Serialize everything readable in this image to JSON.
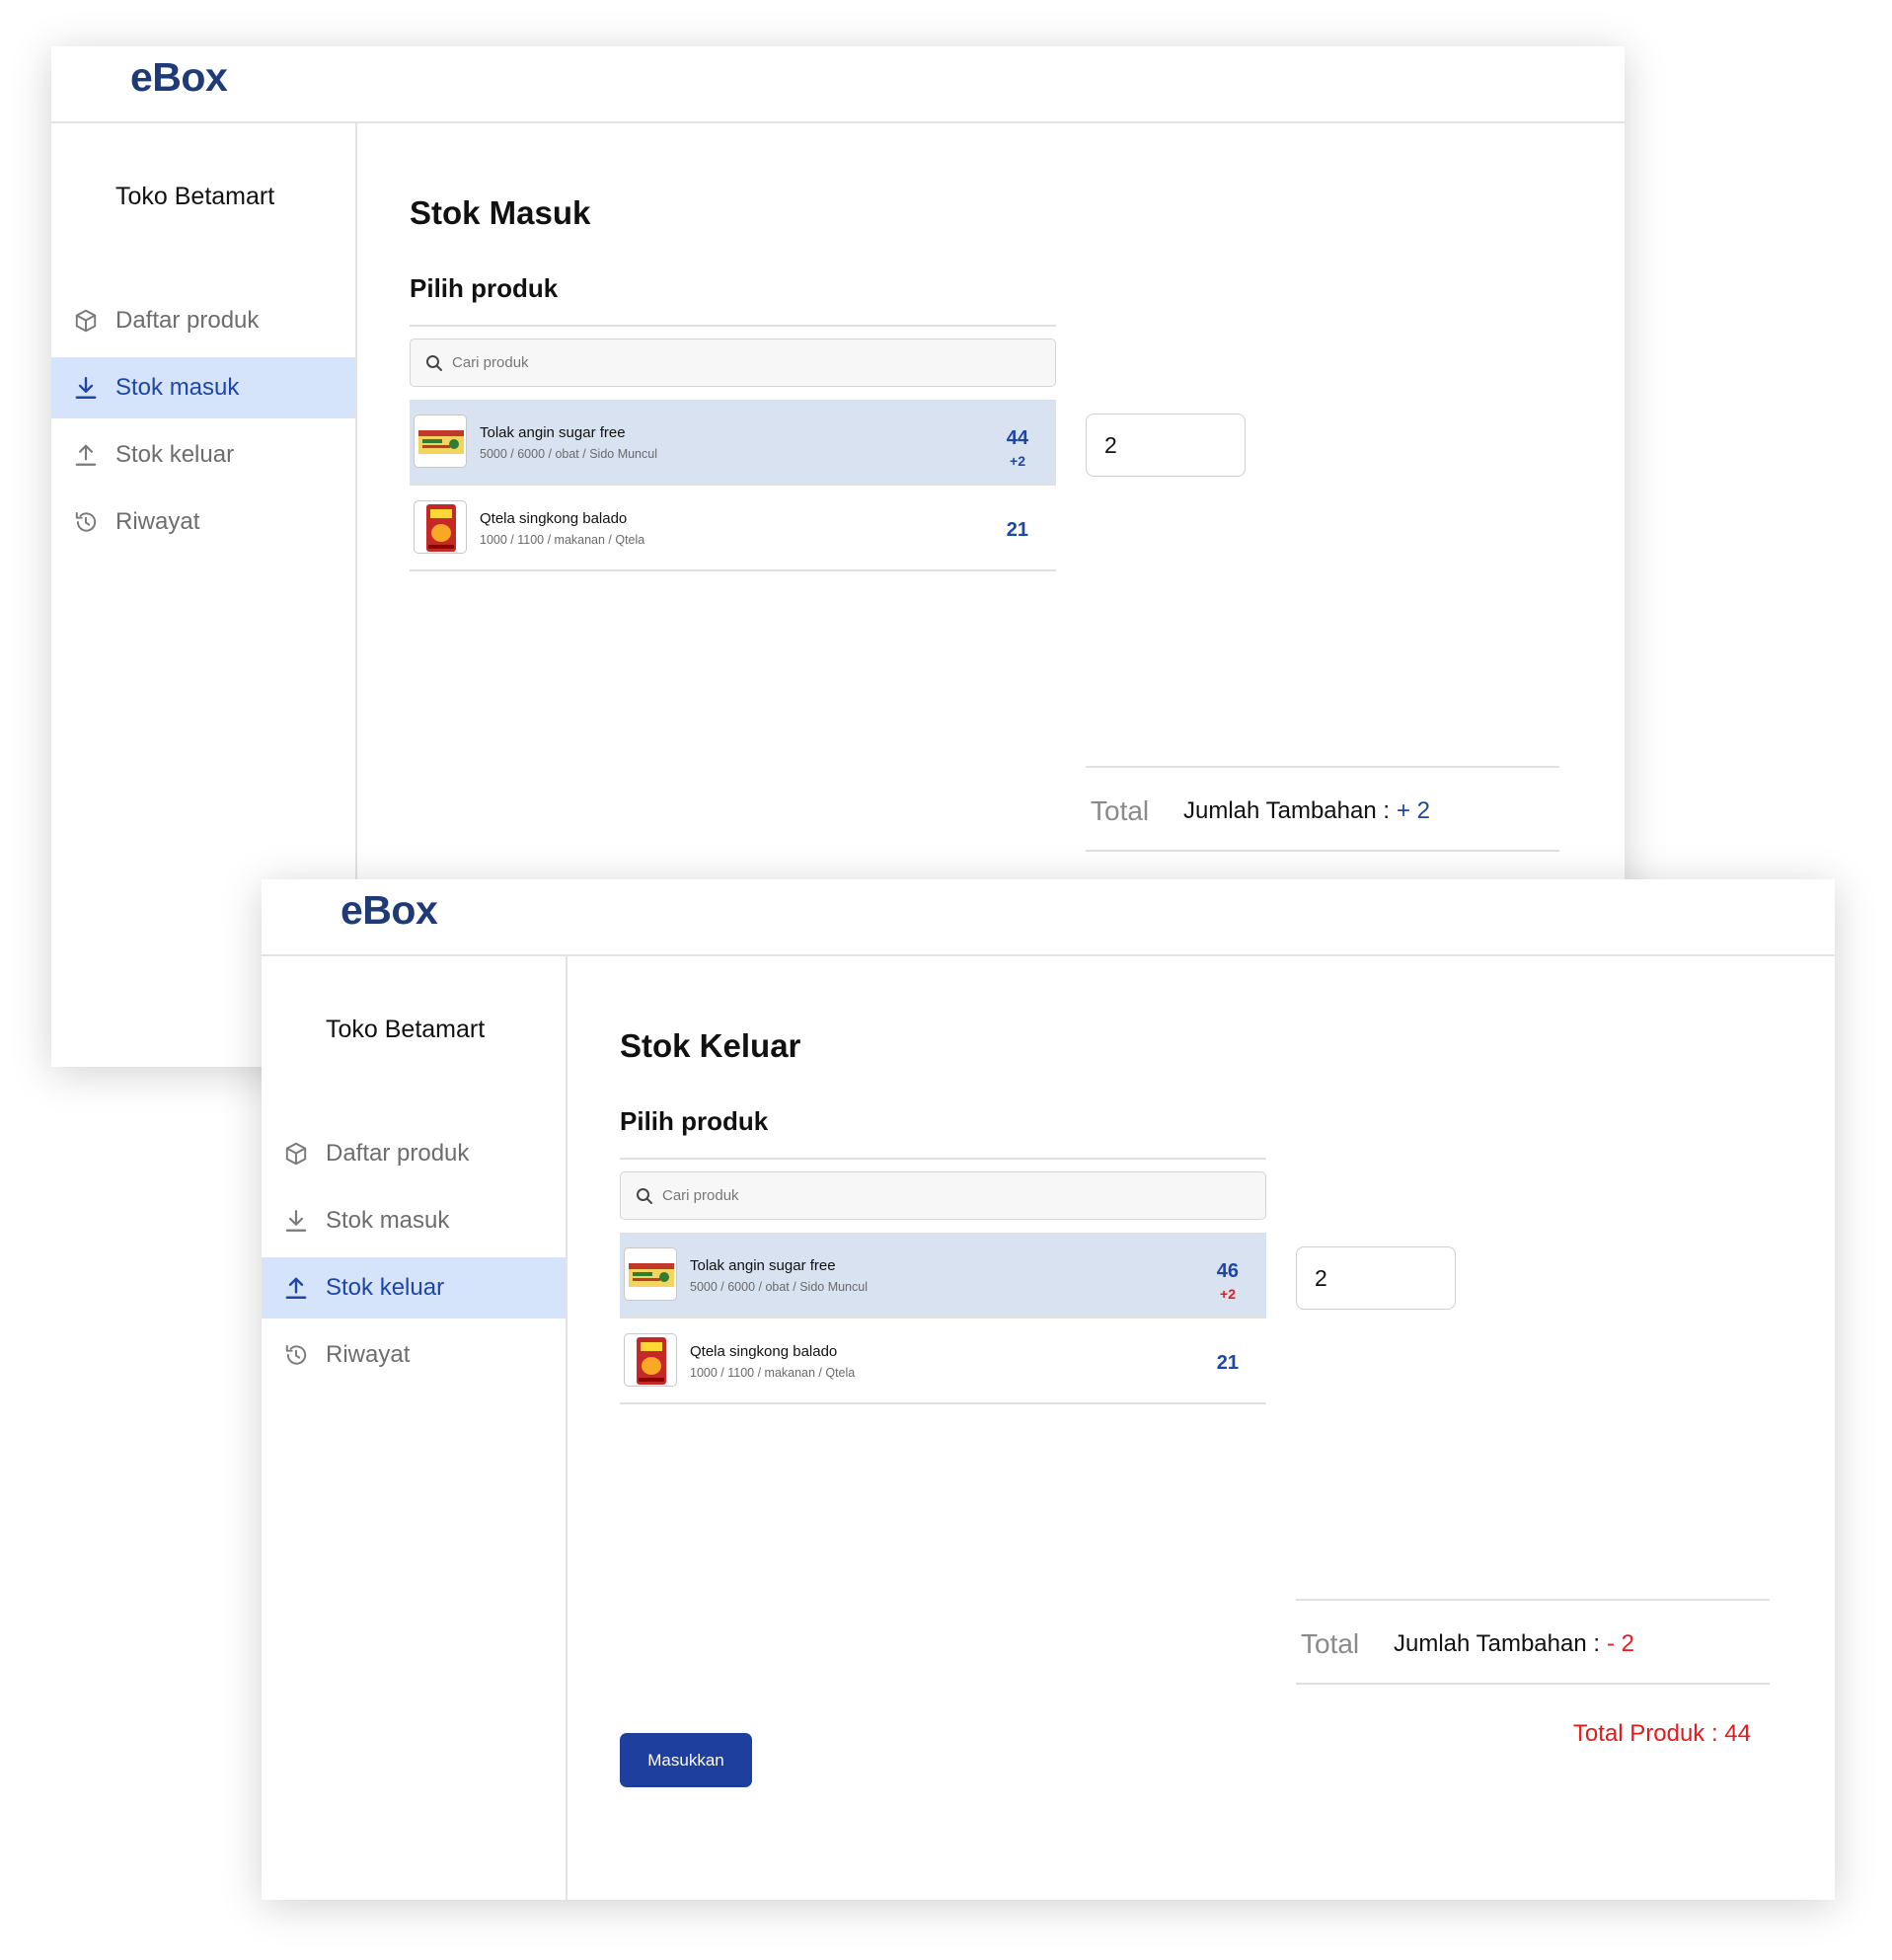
{
  "screens": [
    {
      "logo": "eBox",
      "store_name": "Toko Betamart",
      "nav": [
        {
          "label": "Daftar produk",
          "icon": "box-icon",
          "active": false
        },
        {
          "label": "Stok masuk",
          "icon": "download-icon",
          "active": true
        },
        {
          "label": "Stok keluar",
          "icon": "upload-icon",
          "active": false
        },
        {
          "label": "Riwayat",
          "icon": "history-icon",
          "active": false
        }
      ],
      "page_title": "Stok Masuk",
      "section_title": "Pilih produk",
      "search": {
        "placeholder": "Cari produk",
        "value": ""
      },
      "products": [
        {
          "name": "Tolak angin sugar free",
          "meta": "5000 / 6000 / obat / Sido Muncul",
          "count": "44",
          "delta": "+2",
          "selected": true
        },
        {
          "name": "Qtela singkong balado",
          "meta": "1000 / 1100 / makanan / Qtela",
          "count": "21",
          "delta": "",
          "selected": false
        }
      ],
      "quantity": "2",
      "total_label": "Total",
      "jumlah_label": "Jumlah Tambahan :",
      "jumlah_value": "+ 2"
    },
    {
      "logo": "eBox",
      "store_name": "Toko Betamart",
      "nav": [
        {
          "label": "Daftar produk",
          "icon": "box-icon",
          "active": false
        },
        {
          "label": "Stok masuk",
          "icon": "download-icon",
          "active": false
        },
        {
          "label": "Stok keluar",
          "icon": "upload-icon",
          "active": true
        },
        {
          "label": "Riwayat",
          "icon": "history-icon",
          "active": false
        }
      ],
      "page_title": "Stok Keluar",
      "section_title": "Pilih produk",
      "search": {
        "placeholder": "Cari produk",
        "value": ""
      },
      "products": [
        {
          "name": "Tolak angin sugar free",
          "meta": "5000 / 6000 / obat / Sido Muncul",
          "count": "46",
          "delta": "+2",
          "selected": true
        },
        {
          "name": "Qtela singkong balado",
          "meta": "1000 / 1100 / makanan / Qtela",
          "count": "21",
          "delta": "",
          "selected": false
        }
      ],
      "quantity": "2",
      "total_label": "Total",
      "jumlah_label": "Jumlah Tambahan :",
      "jumlah_value": "- 2",
      "total_produk": "Total Produk : 44",
      "submit_label": "Masukkan"
    }
  ],
  "colors": {
    "brand": "#1f3a78",
    "accent": "#1e46a8",
    "active_nav_bg": "#d5e4fb",
    "selected_row_bg": "#d8e2f1",
    "negative": "#e31b1b",
    "button_bg": "#1e3f9e"
  }
}
